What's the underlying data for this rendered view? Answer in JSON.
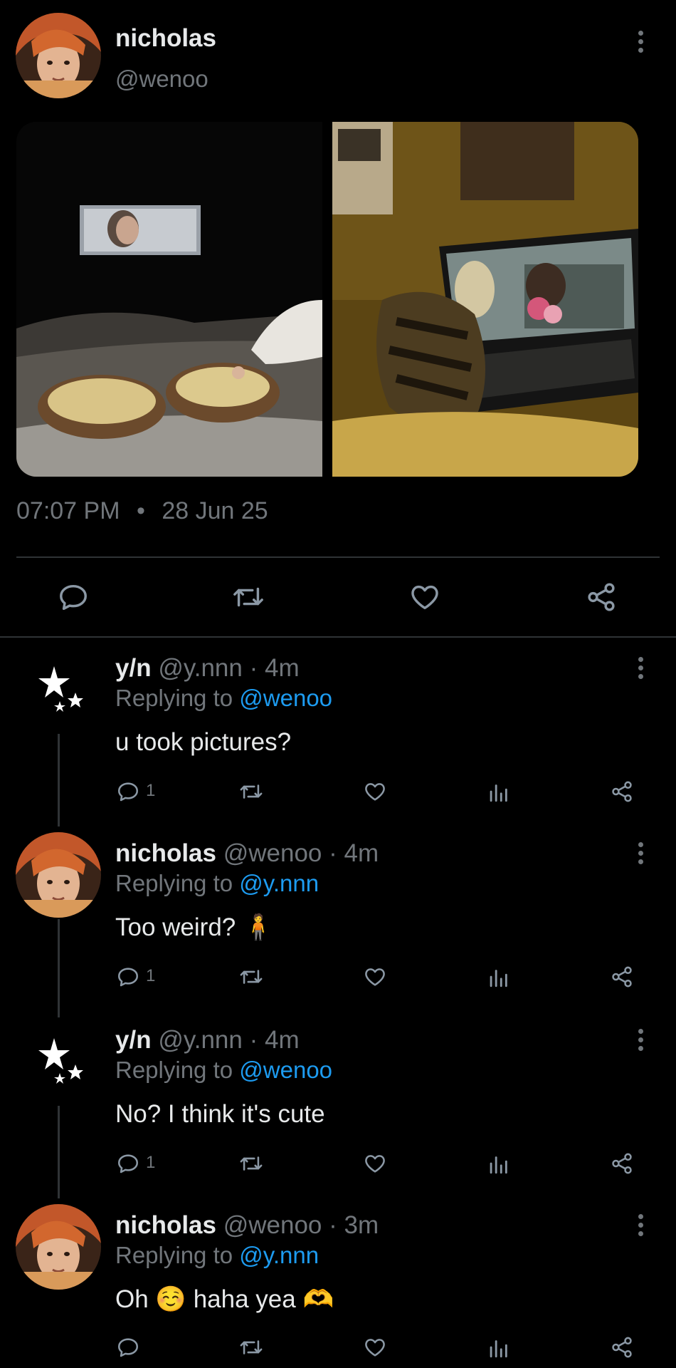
{
  "tweet": {
    "author_name": "nicholas",
    "author_handle": "@wenoo",
    "time": "07:07 PM",
    "separator": "•",
    "date": "28 Jun 25",
    "media": [
      {
        "alt": "popcorn bowls and movie on a projector"
      },
      {
        "alt": "cat watching a movie on a laptop"
      }
    ],
    "actions": [
      "comment-icon",
      "retweet-icon",
      "heart-icon",
      "share-icon"
    ]
  },
  "replies": [
    {
      "name": "y/n",
      "handle": "@y.nnn",
      "time": "· 4m",
      "replying_prefix": "Replying to",
      "replying_to": "@wenoo",
      "text": "u took pictures?",
      "reply_count": "1",
      "avatar": "stars-icon"
    },
    {
      "name": "nicholas",
      "handle": "@wenoo",
      "time": "· 4m",
      "replying_prefix": "Replying to",
      "replying_to": "@y.nnn",
      "text": "Too weird? 🧍",
      "reply_count": "1",
      "avatar": "photo"
    },
    {
      "name": "y/n",
      "handle": "@y.nnn",
      "time": "· 4m",
      "replying_prefix": "Replying to",
      "replying_to": "@wenoo",
      "text": "No? I think it's cute",
      "reply_count": "1",
      "avatar": "stars-icon"
    },
    {
      "name": "nicholas",
      "handle": "@wenoo",
      "time": "· 3m",
      "replying_prefix": "Replying to",
      "replying_to": "@y.nnn",
      "text": "Oh ☺️ haha yea 🫶",
      "reply_count": "",
      "avatar": "photo"
    }
  ],
  "icons": {
    "comment": "comment-icon",
    "retweet": "retweet-icon",
    "like": "heart-icon",
    "analytics": "analytics-icon",
    "share": "share-icon",
    "more": "more-vertical-icon"
  },
  "colors": {
    "background": "#000000",
    "text": "#e7e9ea",
    "muted": "#71767b",
    "link": "#1d9bf0",
    "divider": "#2f3336"
  }
}
